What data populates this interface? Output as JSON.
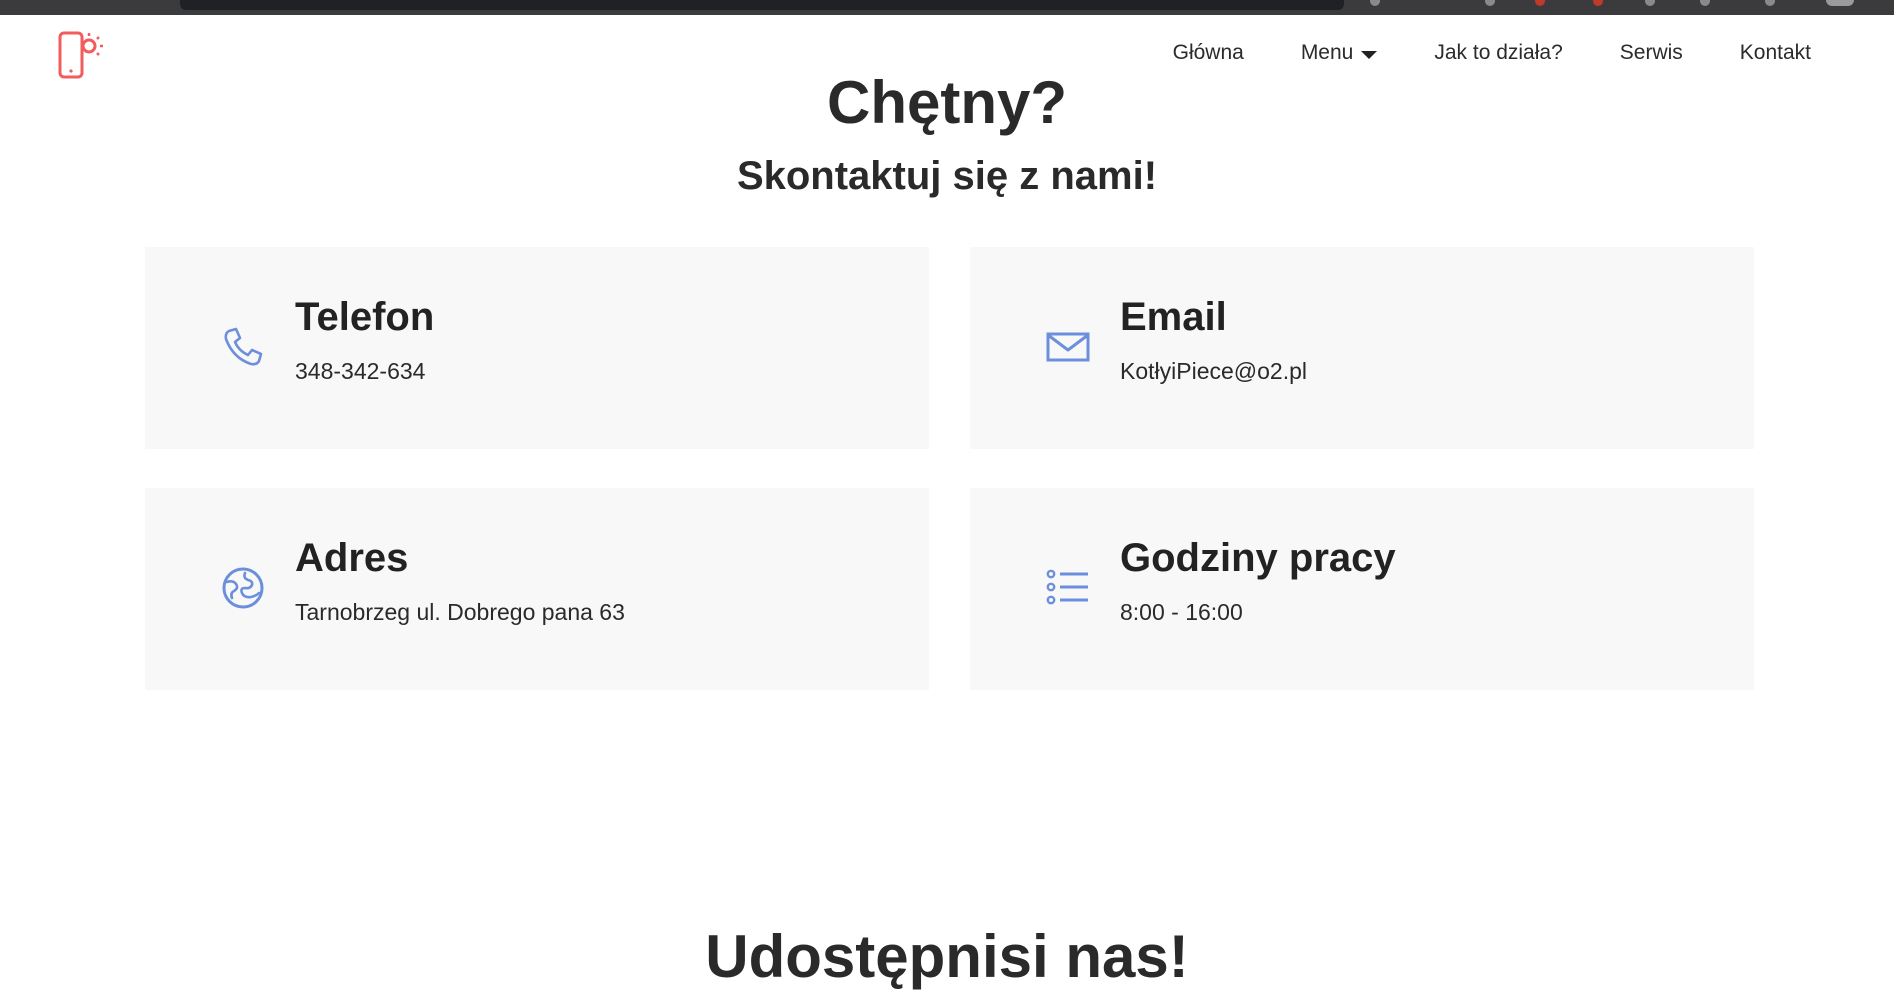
{
  "nav": {
    "items": [
      {
        "label": "Główna"
      },
      {
        "label": "Menu",
        "has_dropdown": true
      },
      {
        "label": "Jak to działa?"
      },
      {
        "label": "Serwis"
      },
      {
        "label": "Kontakt"
      }
    ]
  },
  "brand": {
    "logo_icon": "phone-light-icon",
    "accent_color": "#f25c5c"
  },
  "hero": {
    "title": "Chętny?",
    "subtitle": "Skontaktuj się z nami!"
  },
  "contact": {
    "icon_color": "#6b8fdc",
    "cards": [
      {
        "title": "Telefon",
        "value": "348-342-634",
        "icon": "phone-icon"
      },
      {
        "title": "Email",
        "value": "KotłyiPiece@o2.pl",
        "icon": "mail-icon"
      },
      {
        "title": "Adres",
        "value": "Tarnobrzeg ul. Dobrego pana 63",
        "icon": "globe-icon"
      },
      {
        "title": "Godziny pracy",
        "value": "8:00 - 16:00",
        "icon": "list-icon"
      }
    ]
  },
  "next_section": {
    "title": "Udostępnisi nas!"
  }
}
